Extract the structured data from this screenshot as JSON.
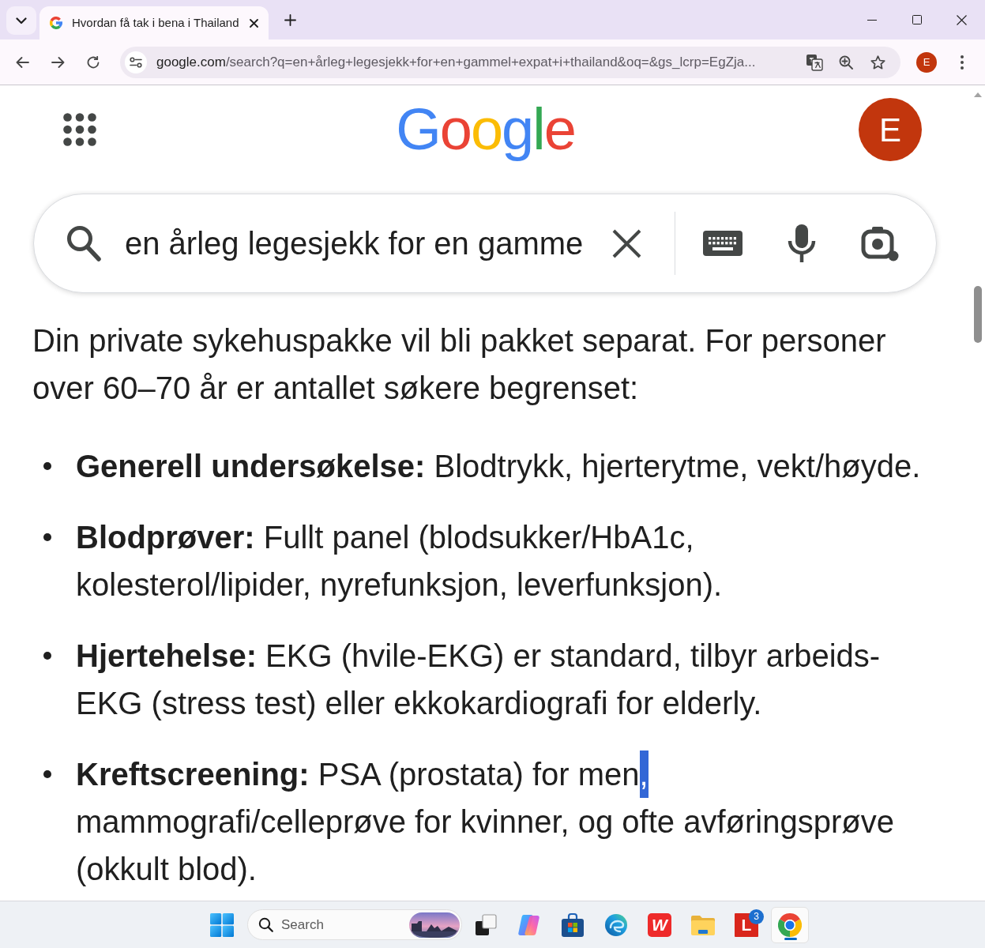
{
  "browser": {
    "tabs": [
      {
        "title": "Hvordan få tak i bena i Thailand",
        "selected": true
      }
    ],
    "address_bar": {
      "host": "google.com",
      "path": "/search?q=en+årleg+legesjekk+for+en+gammel+expat+i+thailand&oq=&gs_lcrp=EgZja..."
    },
    "profile_initial": "E"
  },
  "page": {
    "logo": "Google",
    "account_initial": "E",
    "search": {
      "value": "en årleg legesjekk for en gamme"
    },
    "intro": "Din private sykehuspakke vil bli pakket separat. For personer over 60–70 år er antallet søkere begrenset:",
    "list": [
      {
        "segments": [
          {
            "text": "**Generell undersøkelse:** Blodtrykk, hjerterytme, vekt/høyde.",
            "selected": false
          }
        ]
      },
      {
        "segments": [
          {
            "text": "**Blodprøver:** Fullt panel (blodsukker/HbA1c, kolesterol/lipider, nyrefunksjon, leverfunksjon).",
            "selected": false
          }
        ]
      },
      {
        "segments": [
          {
            "text": "**Hjertehelse:** EKG (hvile-EKG) er standard, tilbyr arbeids-EKG (stress test) eller ekkokardiografi for elderly.",
            "selected": false
          }
        ]
      },
      {
        "segments": [
          {
            "text": "**Kreftscreening:** PSA (prostata) for men",
            "selected": false
          },
          {
            "text": ",",
            "selected": true
          },
          {
            "text": " mammografi/celleprøve for kvinner, og ofte avføringsprøve (okkult blod).",
            "selected": false
          }
        ]
      }
    ]
  },
  "taskbar": {
    "search": {
      "placeholder": "Search"
    },
    "apps": [
      {
        "kind": "task-view",
        "active": false
      },
      {
        "kind": "copilot",
        "active": false
      },
      {
        "kind": "store",
        "active": false
      },
      {
        "kind": "edge",
        "active": false
      },
      {
        "kind": "wps",
        "glyph": "W",
        "active": false
      },
      {
        "kind": "files",
        "active": false
      },
      {
        "kind": "tile",
        "glyph": "L",
        "badge": "3",
        "active": false
      },
      {
        "kind": "chrome",
        "active": true
      }
    ]
  }
}
